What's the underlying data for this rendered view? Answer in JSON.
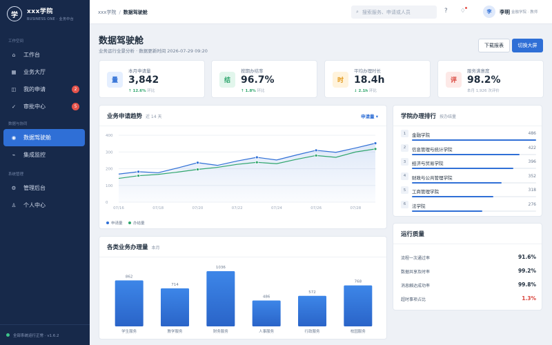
{
  "brand": {
    "logo_char": "学",
    "name": "xxx学院",
    "subtitle": "BUSINESS ONE · 业务中台"
  },
  "sidebar": {
    "sections": [
      {
        "title": "工作空间",
        "items": [
          {
            "label": "工作台",
            "icon": "home-icon",
            "glyph": "⌂"
          },
          {
            "label": "业务大厅",
            "icon": "grid-icon",
            "glyph": "▦"
          },
          {
            "label": "我的申请",
            "icon": "document-icon",
            "glyph": "◫",
            "badge": "2"
          },
          {
            "label": "审批中心",
            "icon": "check-icon",
            "glyph": "✓",
            "badge": "5"
          }
        ]
      },
      {
        "title": "数据与协同",
        "items": [
          {
            "label": "数据驾驶舱",
            "icon": "dashboard-icon",
            "glyph": "◉",
            "active": true
          },
          {
            "label": "集成监控",
            "icon": "pulse-icon",
            "glyph": "⌁"
          }
        ]
      },
      {
        "title": "系统管理",
        "items": [
          {
            "label": "管理后台",
            "icon": "gear-icon",
            "glyph": "⚙"
          },
          {
            "label": "个人中心",
            "icon": "user-icon",
            "glyph": "♙"
          }
        ]
      }
    ],
    "footer": "全部系统运行正常 · v1.6.2"
  },
  "topbar": {
    "breadcrumb_root": "xxx学院",
    "breadcrumb_current": "数据驾驶舱",
    "search_placeholder": "搜索服务、申请或人员",
    "user": {
      "avatar_char": "李",
      "name": "李明",
      "role": "金融学院 · 教师"
    }
  },
  "page": {
    "title": "数据驾驶舱",
    "subtitle": "业务运行全景分析 · 数据更新时间 2026-07-29 09:20",
    "btn_report": "下载报表",
    "btn_fullscreen": "切换大屏"
  },
  "kpis": [
    {
      "icon_char": "量",
      "label": "本月申请量",
      "value": "3,842",
      "trend": "↑ 12.6%",
      "trend_suffix": "环比",
      "icon_bg": "#e5efff",
      "icon_fg": "#2f6fd6"
    },
    {
      "icon_char": "结",
      "label": "按期办结率",
      "value": "96.7%",
      "trend": "↑ 1.8%",
      "trend_suffix": "环比",
      "icon_bg": "#e2f6ec",
      "icon_fg": "#2ea56c"
    },
    {
      "icon_char": "时",
      "label": "平均办理时长",
      "value": "18.4h",
      "trend": "↓ 2.1h",
      "trend_suffix": "环比",
      "icon_bg": "#fff3dc",
      "icon_fg": "#e39a1c"
    },
    {
      "icon_char": "评",
      "label": "服务满意度",
      "value": "98.2%",
      "trend": "本月 1,926 次评价",
      "trend_suffix": "",
      "icon_bg": "#fde9e7",
      "icon_fg": "#d9453d"
    }
  ],
  "trend_panel": {
    "title": "业务申请趋势",
    "note": "近 14 天",
    "select": "申请量 ▾"
  },
  "bar_panel": {
    "title": "各类业务办理量",
    "note": "本月"
  },
  "rank_panel": {
    "title": "学院办理排行",
    "note": "按办结量",
    "rows": [
      {
        "no": "1",
        "name": "金融学院",
        "value": 486
      },
      {
        "no": "2",
        "name": "信息管理与统计学院",
        "value": 422
      },
      {
        "no": "3",
        "name": "经济与贸易学院",
        "value": 396
      },
      {
        "no": "4",
        "name": "财政与公共管理学院",
        "value": 352
      },
      {
        "no": "5",
        "name": "工商管理学院",
        "value": 318
      },
      {
        "no": "6",
        "name": "法学院",
        "value": 276
      }
    ]
  },
  "quality_panel": {
    "title": "运行质量",
    "rows": [
      {
        "label": "流程一次通过率",
        "value": "91.6%",
        "warn": false
      },
      {
        "label": "数据共享及时率",
        "value": "99.2%",
        "warn": false
      },
      {
        "label": "消息触达成功率",
        "value": "99.8%",
        "warn": false
      },
      {
        "label": "超时事项占比",
        "value": "1.3%",
        "warn": true
      }
    ]
  },
  "chart_data": [
    {
      "type": "line",
      "title": "业务申请趋势",
      "x": [
        "07/16",
        "07/17",
        "07/18",
        "07/19",
        "07/20",
        "07/21",
        "07/22",
        "07/23",
        "07/24",
        "07/25",
        "07/26",
        "07/27",
        "07/28",
        "07/29"
      ],
      "x_tick_labels": [
        "07/16",
        "07/18",
        "07/20",
        "07/22",
        "07/24",
        "07/26",
        "07/28"
      ],
      "y_ticks": [
        0,
        100,
        200,
        300,
        400
      ],
      "ylim": [
        0,
        400
      ],
      "grid": true,
      "legend": "bottom-left",
      "series": [
        {
          "name": "申请量",
          "color": "#2f6fd6",
          "values": [
            168,
            182,
            176,
            205,
            236,
            220,
            246,
            268,
            252,
            282,
            310,
            298,
            324,
            352
          ]
        },
        {
          "name": "办结量",
          "color": "#2ea56c",
          "values": [
            142,
            158,
            166,
            180,
            196,
            208,
            226,
            238,
            230,
            256,
            279,
            268,
            300,
            318
          ]
        }
      ]
    },
    {
      "type": "bar",
      "title": "各类业务办理量",
      "categories": [
        "学生服务",
        "教学服务",
        "财务服务",
        "人事服务",
        "行政服务",
        "校园服务"
      ],
      "values": [
        862,
        714,
        1036,
        486,
        572,
        768
      ],
      "color_top": "#3d86e8",
      "color_bottom": "#2a64c8"
    }
  ]
}
